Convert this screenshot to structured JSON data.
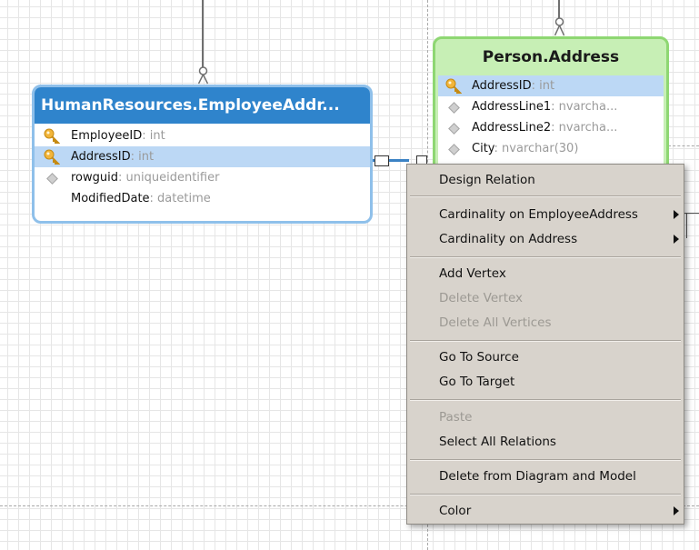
{
  "tables": {
    "employee_address": {
      "title": "HumanResources.EmployeeAddr...",
      "columns": [
        {
          "name": "EmployeeID",
          "type": ": int",
          "key": "primary"
        },
        {
          "name": "AddressID",
          "type": ": int",
          "key": "primary"
        },
        {
          "name": "rowguid",
          "type": ": uniqueidentifier",
          "key": "none"
        },
        {
          "name": "ModifiedDate",
          "type": ": datetime",
          "key": "none"
        }
      ],
      "header_color": "#2f84cc"
    },
    "person_address": {
      "title": "Person.Address",
      "columns": [
        {
          "name": "AddressID",
          "type": ": int",
          "key": "primary"
        },
        {
          "name": "AddressLine1",
          "type": ": nvarcha...",
          "key": "none"
        },
        {
          "name": "AddressLine2",
          "type": ": nvarcha...",
          "key": "none"
        },
        {
          "name": "City",
          "type": ": nvarchar(30)",
          "key": "none"
        }
      ],
      "header_color": "#c7efb5"
    }
  },
  "context_menu": {
    "items": [
      {
        "label": "Design Relation",
        "enabled": true,
        "submenu": false
      },
      {
        "label": "Cardinality on EmployeeAddress",
        "enabled": true,
        "submenu": true
      },
      {
        "label": "Cardinality on Address",
        "enabled": true,
        "submenu": true
      },
      {
        "label": "Add Vertex",
        "enabled": true,
        "submenu": false
      },
      {
        "label": "Delete Vertex",
        "enabled": false,
        "submenu": false
      },
      {
        "label": "Delete All Vertices",
        "enabled": false,
        "submenu": false
      },
      {
        "label": "Go To Source",
        "enabled": true,
        "submenu": false
      },
      {
        "label": "Go To Target",
        "enabled": true,
        "submenu": false
      },
      {
        "label": "Paste",
        "enabled": false,
        "submenu": false
      },
      {
        "label": "Select All Relations",
        "enabled": true,
        "submenu": false
      },
      {
        "label": "Delete from Diagram and Model",
        "enabled": true,
        "submenu": false
      },
      {
        "label": "Color",
        "enabled": true,
        "submenu": true
      }
    ]
  },
  "icons": {
    "primary_key": "key-icon",
    "regular_column": "diamond-icon",
    "submenu": "chevron-right-icon"
  }
}
